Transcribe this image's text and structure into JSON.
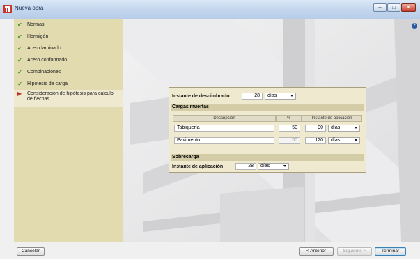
{
  "window": {
    "title": "Nueva obra"
  },
  "sidebar": {
    "items": [
      {
        "label": "Normas",
        "status": "done"
      },
      {
        "label": "Hormigón",
        "status": "done"
      },
      {
        "label": "Acero laminado",
        "status": "done"
      },
      {
        "label": "Acero conformado",
        "status": "done"
      },
      {
        "label": "Combinaciones",
        "status": "done"
      },
      {
        "label": "Hipótesis de carga",
        "status": "done"
      },
      {
        "label": "Consideración de hipótesis para cálculo",
        "label2": "de flechas",
        "status": "current"
      }
    ]
  },
  "panel": {
    "descimbrado_label": "Instante de descimbrado",
    "descimbrado_value": "28",
    "descimbrado_unit": "días",
    "cargas_muertas_title": "Cargas muertas",
    "headers": {
      "description": "Descripción",
      "percent": "%",
      "instant": "Instante de aplicación"
    },
    "rows": [
      {
        "description": "Tabiquería",
        "percent": "50",
        "instant": "90",
        "unit": "días"
      },
      {
        "description": "Pavimento",
        "percent": "50",
        "instant": "120",
        "unit": "días"
      }
    ],
    "sobrecarga_title": "Sobrecarga",
    "aplicacion_label": "Instante de aplicación",
    "aplicacion_value": "28",
    "aplicacion_unit": "días"
  },
  "buttons": {
    "cancel": "Cancelar",
    "previous": "< Anterior",
    "next": "Siguiente >",
    "finish": "Terminar"
  },
  "colors": {
    "sidebar": "#e3dbb0",
    "panel": "#efe9d0",
    "band": "#d4cca6"
  }
}
